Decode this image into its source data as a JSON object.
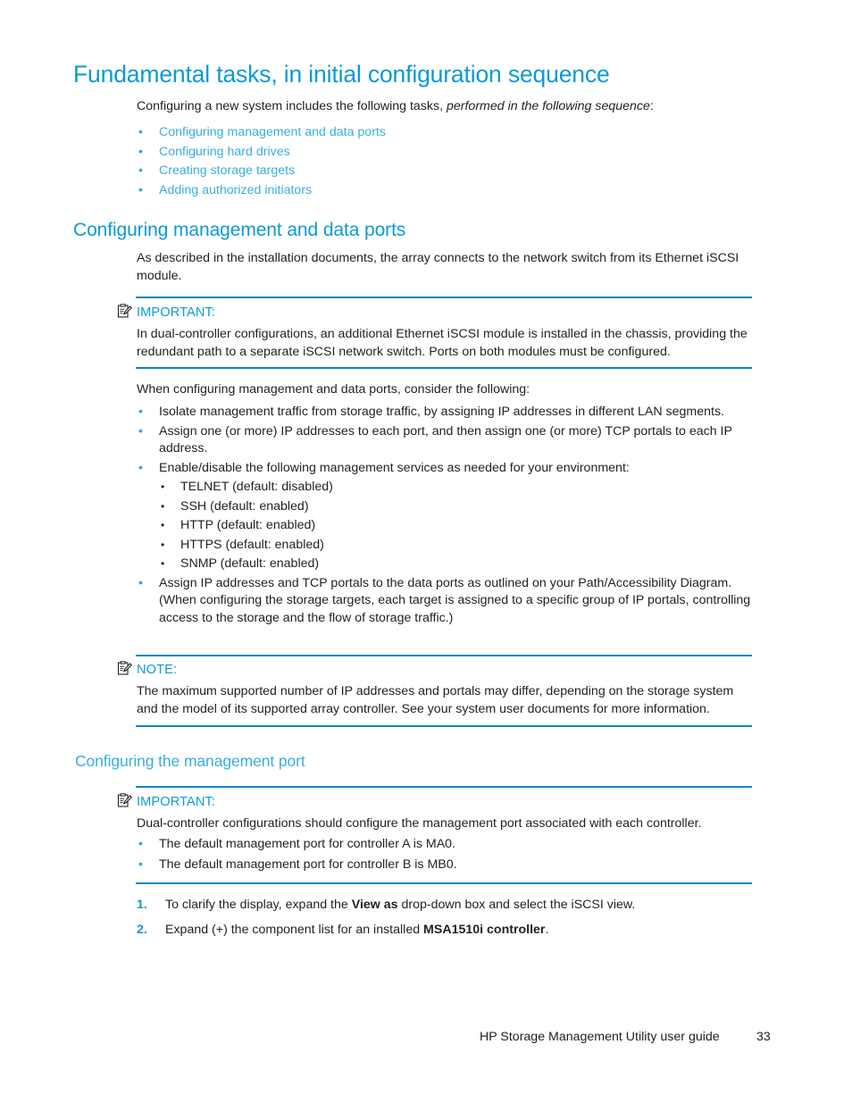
{
  "document": {
    "heading1": "Fundamental tasks, in initial configuration sequence",
    "intro": {
      "before_italic": "Configuring a new system includes the following tasks, ",
      "italic": "performed in the following sequence",
      "after_italic": ":"
    },
    "task_links": [
      "Configuring management and data ports",
      "Configuring hard drives",
      "Creating storage targets",
      "Adding authorized initiators"
    ],
    "section1": {
      "heading2": "Configuring management and data ports",
      "para1": "As described in the installation documents, the array connects to the network switch from its Ethernet iSCSI module.",
      "important1": {
        "icon": "important-note-icon",
        "label": "IMPORTANT:",
        "body": "In dual-controller configurations, an additional Ethernet iSCSI module is installed in the chassis, providing the redundant path to a separate iSCSI network switch. Ports on both modules must be configured."
      },
      "para2": "When configuring management and data ports, consider the following:",
      "bullets": [
        "Isolate management traffic from storage traffic, by assigning IP addresses in different LAN segments.",
        "Assign one (or more) IP addresses to each port, and then assign one (or more) TCP portals to each IP address.",
        "Enable/disable the following management services as needed for your environment:"
      ],
      "services": [
        "TELNET (default:  disabled)",
        "SSH (default:  enabled)",
        "HTTP (default:  enabled)",
        "HTTPS (default:  enabled)",
        "SNMP (default:  enabled)"
      ],
      "bullet_last": "Assign IP addresses and TCP portals to the data ports as outlined on your Path/Accessibility Diagram. (When configuring the storage targets, each target is assigned to a specific group of IP portals, controlling access to the storage and the flow of storage traffic.)",
      "note1": {
        "icon": "note-icon",
        "label": "NOTE:",
        "body": "The maximum supported number of IP addresses and portals may differ, depending on the storage system and the model of its supported array controller.  See your system user documents for more information."
      }
    },
    "section2": {
      "heading3": "Configuring the management port",
      "important2": {
        "icon": "important-note-icon",
        "label": "IMPORTANT:",
        "body": "Dual-controller configurations should configure the management port associated with each controller.",
        "bullets": [
          "The default management port for controller A is MA0.",
          "The default management port for controller B is MB0."
        ]
      },
      "steps": [
        {
          "number": "1.",
          "before_bold": "To clarify the display, expand the ",
          "bold": "View as",
          "after_bold": " drop-down box and select the iSCSI view."
        },
        {
          "number": "2.",
          "before_bold": "Expand (+) the component list for an installed ",
          "bold": "MSA1510i controller",
          "after_bold": "."
        }
      ]
    },
    "footer": {
      "guide_title": "HP Storage Management Utility user guide",
      "page_number": "33"
    },
    "colors": {
      "heading_blue": "#0b9ad6",
      "link_blue": "#3aadde",
      "rule_blue": "#0b87c4",
      "body_black": "#231f20"
    }
  }
}
